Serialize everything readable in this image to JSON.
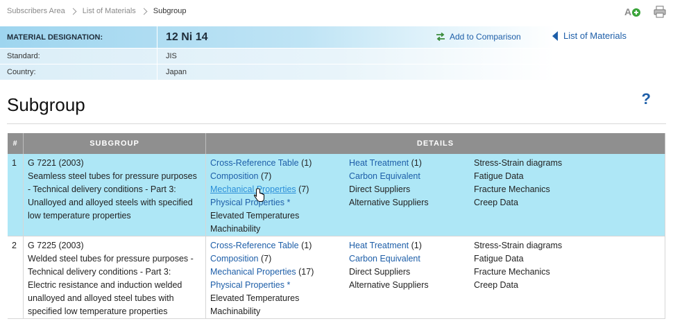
{
  "breadcrumb": [
    "Subscribers Area",
    "List of Materials",
    "Subgroup"
  ],
  "icons": {
    "add_language": "a-plus-icon",
    "print": "printer-icon"
  },
  "material": {
    "designation_label": "MATERIAL DESIGNATION:",
    "designation_value": "12 Ni 14",
    "standard_label": "Standard:",
    "standard_value": "JIS",
    "country_label": "Country:",
    "country_value": "Japan",
    "add_comparison": "Add to Comparison",
    "list_of_materials": "List of Materials"
  },
  "page_title": "Subgroup",
  "help": "?",
  "table": {
    "headers": {
      "num": "#",
      "subgroup": "SUBGROUP",
      "details": "DETAILS"
    },
    "rows": [
      {
        "num": "1",
        "code": "G 7221 (2003)",
        "desc": "Seamless steel tubes for pressure purposes - Technical delivery conditions - Part 3: Unalloyed and alloyed steels with specified low temperature properties",
        "col1": [
          {
            "label": "Cross-Reference Table",
            "count": " (1)",
            "link": true
          },
          {
            "label": "Composition",
            "count": " (7)",
            "link": true
          },
          {
            "label": "Mechanical Properties",
            "count": " (7)",
            "link": true
          },
          {
            "label": "Physical Properties *",
            "count": "",
            "link": true
          },
          {
            "label": "Elevated Temperatures",
            "count": "",
            "link": false
          },
          {
            "label": "Machinability",
            "count": "",
            "link": false
          }
        ],
        "col2": [
          {
            "label": "Heat Treatment",
            "count": " (1)",
            "link": true
          },
          {
            "label": "Carbon Equivalent",
            "count": "",
            "link": true
          },
          {
            "label": "Direct Suppliers",
            "count": "",
            "link": false
          },
          {
            "label": "Alternative Suppliers",
            "count": "",
            "link": false
          }
        ],
        "col3": [
          {
            "label": "Stress-Strain diagrams",
            "count": "",
            "link": false
          },
          {
            "label": "Fatigue Data",
            "count": "",
            "link": false
          },
          {
            "label": "Fracture Mechanics",
            "count": "",
            "link": false
          },
          {
            "label": "Creep Data",
            "count": "",
            "link": false
          }
        ]
      },
      {
        "num": "2",
        "code": "G 7225 (2003)",
        "desc": "Welded steel tubes for pressure purposes - Technical delivery conditions - Part 3: Electric resistance and induction welded unalloyed and alloyed steel tubes with specified low temperature properties",
        "col1": [
          {
            "label": "Cross-Reference Table",
            "count": " (1)",
            "link": true
          },
          {
            "label": "Composition",
            "count": " (7)",
            "link": true
          },
          {
            "label": "Mechanical Properties",
            "count": " (17)",
            "link": true
          },
          {
            "label": "Physical Properties *",
            "count": "",
            "link": true
          },
          {
            "label": "Elevated Temperatures",
            "count": "",
            "link": false
          },
          {
            "label": "Machinability",
            "count": "",
            "link": false
          }
        ],
        "col2": [
          {
            "label": "Heat Treatment",
            "count": " (1)",
            "link": true
          },
          {
            "label": "Carbon Equivalent",
            "count": "",
            "link": true
          },
          {
            "label": "Direct Suppliers",
            "count": "",
            "link": false
          },
          {
            "label": "Alternative Suppliers",
            "count": "",
            "link": false
          }
        ],
        "col3": [
          {
            "label": "Stress-Strain diagrams",
            "count": "",
            "link": false
          },
          {
            "label": "Fatigue Data",
            "count": "",
            "link": false
          },
          {
            "label": "Fracture Mechanics",
            "count": "",
            "link": false
          },
          {
            "label": "Creep Data",
            "count": "",
            "link": false
          }
        ]
      }
    ]
  }
}
